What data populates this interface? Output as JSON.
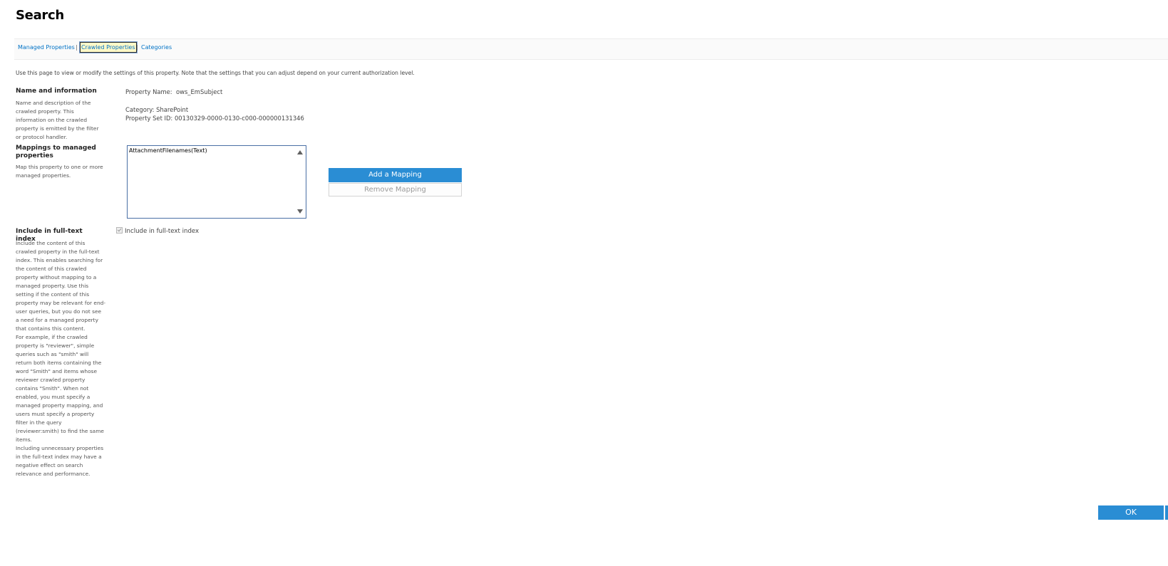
{
  "page": {
    "title": "Search"
  },
  "tabs": [
    {
      "label": "Managed Properties"
    },
    {
      "label": "Crawled Properties"
    },
    {
      "label": "Categories"
    }
  ],
  "tab_separator": "|",
  "intro": "Use this page to view or modify the settings of this property. Note that the settings that you can adjust depend on your current authorization level.",
  "name_info": {
    "title": "Name and information",
    "desc": "Name and description of the crawled property. This information on the crawled property is emitted by the filter or protocol handler.",
    "property_name_label": "Property Name:",
    "property_name_value": "ows_EmSubject",
    "category_label": "Category:",
    "category_value": "SharePoint",
    "property_set_label": "Property Set ID:",
    "property_set_value": "00130329-0000-0130-c000-000000131346"
  },
  "mappings": {
    "title": "Mappings to managed properties",
    "desc": "Map this property to one or more managed properties.",
    "items": [
      "AttachmentFilenames(Text)"
    ],
    "add_label": "Add a Mapping",
    "remove_label": "Remove Mapping"
  },
  "fulltext": {
    "title": "Include in full-text index",
    "desc": [
      "Include the content of this crawled property in the full-text index. This enables searching for the content of this crawled property without mapping to a managed property. Use this setting if the content of this property may be relevant for end-user queries, but you do not see a need for a managed property that contains this content.",
      "For example, if the crawled property is \"reviewer\", simple queries such as \"smith\" will return both items containing the word \"Smith\" and items whose reviewer crawled property contains \"Smith\".  When not enabled, you must specify a managed property mapping, and users must specify a property filter in the query (reviewer:smith) to find the same items.",
      "Including unnecessary properties in the full-text index may have a negative effect on search relevance and performance."
    ],
    "checkbox_label": "Include in full-text index",
    "checked": true
  },
  "footer": {
    "ok_label": "OK"
  },
  "colors": {
    "accent": "#2a8dd4",
    "link": "#0072c6"
  }
}
